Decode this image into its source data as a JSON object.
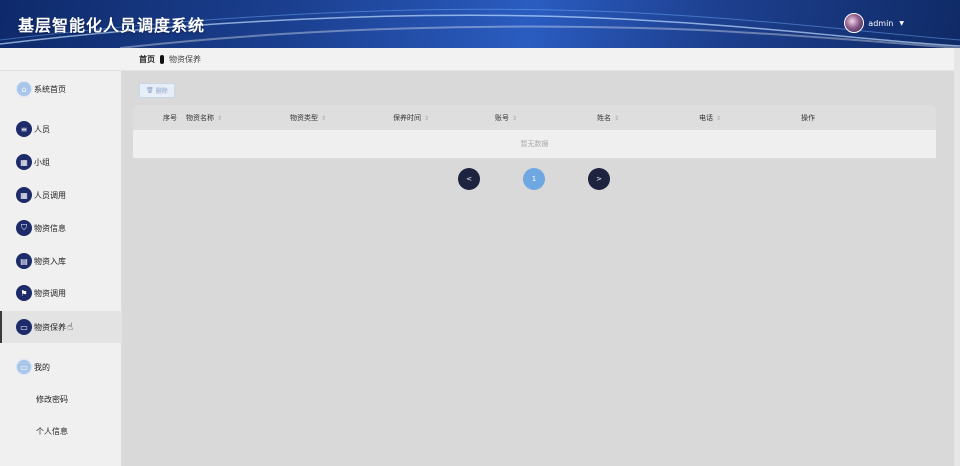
{
  "header": {
    "app_title": "基层智能化人员调度系统",
    "username": "admin",
    "caret": "▼"
  },
  "breadcrumb": {
    "home": "首页",
    "current": "物资保养"
  },
  "sidebar": {
    "items": [
      {
        "label": "系统首页",
        "icon": "home-icon",
        "glyph": "⌂"
      },
      {
        "label": "人员",
        "icon": "list-icon",
        "glyph": "≡"
      },
      {
        "label": "小组",
        "icon": "grid-icon",
        "glyph": "▦"
      },
      {
        "label": "人员调用",
        "icon": "grid-icon",
        "glyph": "▦"
      },
      {
        "label": "物资信息",
        "icon": "shield-icon",
        "glyph": "⛉"
      },
      {
        "label": "物资入库",
        "icon": "clipboard-icon",
        "glyph": "▤"
      },
      {
        "label": "物资调用",
        "icon": "flag-icon",
        "glyph": "⚑"
      },
      {
        "label": "物资保养",
        "icon": "briefcase-icon",
        "glyph": "▭"
      },
      {
        "label": "我的",
        "icon": "window-icon",
        "glyph": "▭"
      }
    ],
    "sub_items": [
      "修改密码",
      "个人信息"
    ]
  },
  "toolbar": {
    "delete_label": "删除",
    "delete_icon": "trash-icon"
  },
  "table": {
    "columns": [
      "序号",
      "物资名称",
      "物资类型",
      "保养时间",
      "账号",
      "姓名",
      "电话",
      "操作"
    ],
    "sort_glyph": "⇕",
    "empty_text": "暂无数据"
  },
  "pagination": {
    "prev": "<",
    "current_page": "1",
    "next": ">"
  },
  "colors": {
    "header_bg": "#1b3f8f",
    "nav_icon": "#1d2b6b",
    "pager_dark": "#1e2440",
    "pager_current": "#6ea7e2"
  }
}
